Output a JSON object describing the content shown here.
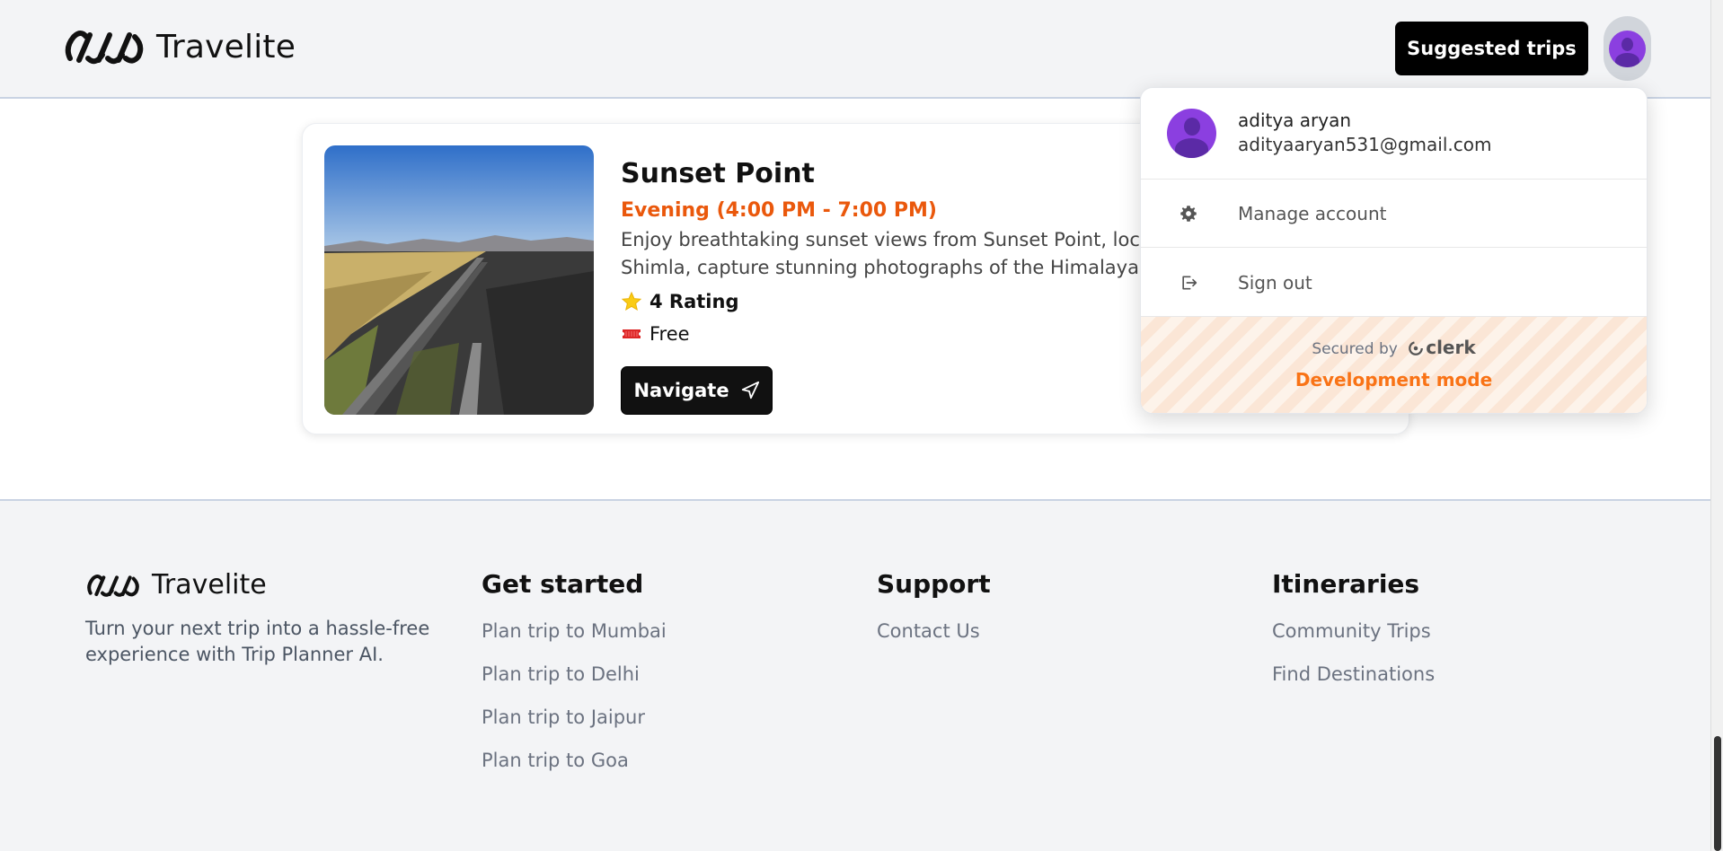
{
  "header": {
    "brand": "Travelite",
    "suggested_button": "Suggested trips"
  },
  "place": {
    "title": "Sunset Point",
    "time": "Evening (4:00 PM - 7:00 PM)",
    "description_line1": "Enjoy breathtaking sunset views from Sunset Point, loca",
    "description_line2": "Shimla, capture stunning photographs of the Himalayas",
    "rating": "4 Rating",
    "price": "Free",
    "navigate_button": "Navigate"
  },
  "user_menu": {
    "name": "aditya aryan",
    "email": "adityaaryan531@gmail.com",
    "manage_account": "Manage account",
    "sign_out": "Sign out",
    "secured_by": "Secured by",
    "clerk_brand": "clerk",
    "dev_mode": "Development mode"
  },
  "footer": {
    "brand": "Travelite",
    "tagline": "Turn your next trip into a hassle-free experience with Trip Planner AI.",
    "columns": [
      {
        "title": "Get started",
        "links": [
          "Plan trip to Mumbai",
          "Plan trip to Delhi",
          "Plan trip to Jaipur",
          "Plan trip to Goa"
        ]
      },
      {
        "title": "Support",
        "links": [
          "Contact Us"
        ]
      },
      {
        "title": "Itineraries",
        "links": [
          "Community Trips",
          "Find Destinations"
        ]
      }
    ]
  },
  "colors": {
    "accent_orange": "#ea580c",
    "avatar_purple": "#8b3fe0",
    "dev_mode_orange": "#f97316"
  },
  "icons": [
    "logo-infinity-icon",
    "star-icon",
    "ticket-icon",
    "navigation-arrow-icon",
    "gear-icon",
    "sign-out-icon",
    "clerk-logo-icon"
  ]
}
